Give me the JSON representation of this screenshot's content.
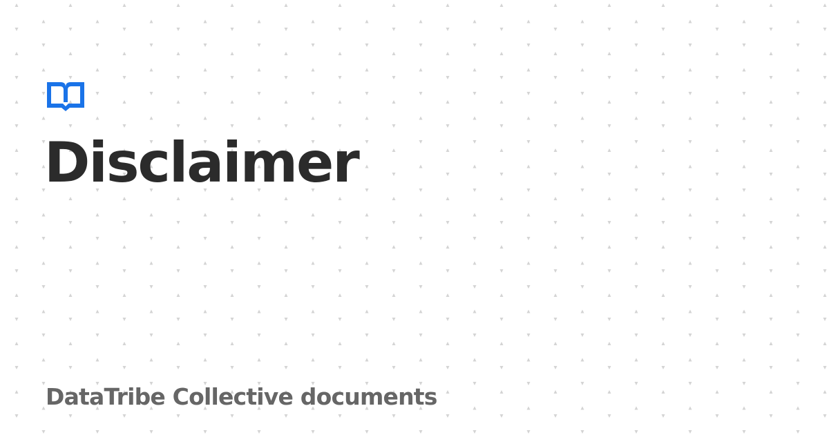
{
  "page": {
    "title": "Disclaimer",
    "site_name": "DataTribe Collective documents"
  },
  "icons": {
    "logo": "open-book-icon"
  },
  "colors": {
    "accent": "#1a73e8",
    "title": "#2b2b2b",
    "subtitle": "#666666",
    "background": "#ffffff",
    "pattern": "#d4d4d4"
  }
}
